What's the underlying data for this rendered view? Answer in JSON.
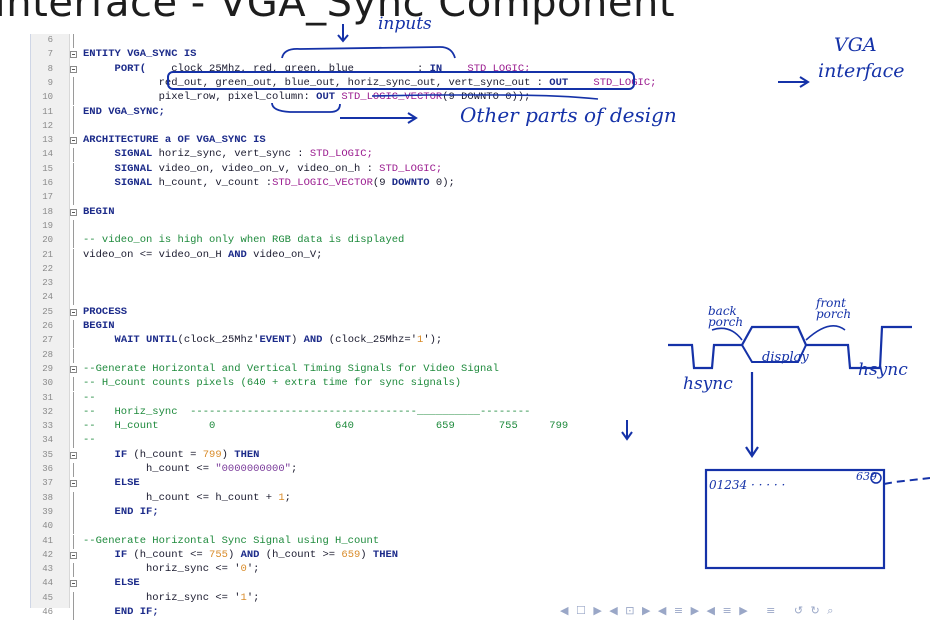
{
  "slide": {
    "title": "Interface - VGA_Sync Component"
  },
  "lines": [
    {
      "n": "6",
      "tokens": []
    },
    {
      "n": "7",
      "fold": true,
      "tokens": [
        {
          "t": "ENTITY VGA_SYNC IS",
          "c": "kw"
        }
      ]
    },
    {
      "n": "8",
      "fold": true,
      "tokens": [
        {
          "t": "     "
        },
        {
          "t": "PORT(",
          "c": "kw"
        },
        {
          "t": "    clock_25Mhz, red, green, blue          : "
        },
        {
          "t": "IN",
          "c": "kw"
        },
        {
          "t": "    "
        },
        {
          "t": "STD_LOGIC;",
          "c": "ty"
        }
      ]
    },
    {
      "n": "9",
      "tokens": [
        {
          "t": "            red_out, green_out, blue_out, horiz_sync_out, vert_sync_out : "
        },
        {
          "t": "OUT",
          "c": "kw"
        },
        {
          "t": "    "
        },
        {
          "t": "STD_LOGIC;",
          "c": "ty"
        }
      ]
    },
    {
      "n": "10",
      "tokens": [
        {
          "t": "            pixel_row, pixel_column: "
        },
        {
          "t": "OUT",
          "c": "kw"
        },
        {
          "t": " "
        },
        {
          "t": "STD_LOGIC_VECTOR",
          "c": "ty"
        },
        {
          "t": "(9 DOWNTO 0));"
        }
      ]
    },
    {
      "n": "11",
      "tokens": [
        {
          "t": "END VGA_SYNC;",
          "c": "kw"
        }
      ]
    },
    {
      "n": "12",
      "tokens": []
    },
    {
      "n": "13",
      "fold": true,
      "tokens": [
        {
          "t": "ARCHITECTURE a OF VGA_SYNC IS",
          "c": "kw"
        }
      ]
    },
    {
      "n": "14",
      "tokens": [
        {
          "t": "     "
        },
        {
          "t": "SIGNAL",
          "c": "kw"
        },
        {
          "t": " horiz_sync, vert_sync : "
        },
        {
          "t": "STD_LOGIC;",
          "c": "ty"
        }
      ]
    },
    {
      "n": "15",
      "tokens": [
        {
          "t": "     "
        },
        {
          "t": "SIGNAL",
          "c": "kw"
        },
        {
          "t": " video_on, video_on_v, video_on_h : "
        },
        {
          "t": "STD_LOGIC;",
          "c": "ty"
        }
      ]
    },
    {
      "n": "16",
      "tokens": [
        {
          "t": "     "
        },
        {
          "t": "SIGNAL",
          "c": "kw"
        },
        {
          "t": " h_count, v_count :"
        },
        {
          "t": "STD_LOGIC_VECTOR",
          "c": "ty"
        },
        {
          "t": "(9 "
        },
        {
          "t": "DOWNTO",
          "c": "kw"
        },
        {
          "t": " 0);"
        }
      ]
    },
    {
      "n": "17",
      "tokens": []
    },
    {
      "n": "18",
      "fold": true,
      "tokens": [
        {
          "t": "BEGIN",
          "c": "kw"
        }
      ]
    },
    {
      "n": "19",
      "tokens": []
    },
    {
      "n": "20",
      "tokens": [
        {
          "t": "-- video_on is high only when RGB data is displayed",
          "c": "cm"
        }
      ]
    },
    {
      "n": "21",
      "tokens": [
        {
          "t": "video_on <= video_on_H "
        },
        {
          "t": "AND",
          "c": "kw"
        },
        {
          "t": " video_on_V;"
        }
      ]
    },
    {
      "n": "22",
      "tokens": []
    },
    {
      "n": "23",
      "tokens": []
    },
    {
      "n": "24",
      "tokens": []
    },
    {
      "n": "25",
      "fold": true,
      "tokens": [
        {
          "t": "PROCESS",
          "c": "kw"
        }
      ]
    },
    {
      "n": "26",
      "tokens": [
        {
          "t": "BEGIN",
          "c": "kw"
        }
      ]
    },
    {
      "n": "27",
      "tokens": [
        {
          "t": "     "
        },
        {
          "t": "WAIT UNTIL",
          "c": "kw"
        },
        {
          "t": "(clock_25Mhz'"
        },
        {
          "t": "EVENT",
          "c": "kw"
        },
        {
          "t": ") "
        },
        {
          "t": "AND",
          "c": "kw"
        },
        {
          "t": " (clock_25Mhz='"
        },
        {
          "t": "1",
          "c": "nm"
        },
        {
          "t": "');"
        }
      ]
    },
    {
      "n": "28",
      "tokens": []
    },
    {
      "n": "29",
      "fold": true,
      "tokens": [
        {
          "t": "--Generate Horizontal and Vertical Timing Signals for Video Signal",
          "c": "cm"
        }
      ]
    },
    {
      "n": "30",
      "tokens": [
        {
          "t": "-- H_count counts pixels (640 + extra time for sync signals)",
          "c": "cm"
        }
      ]
    },
    {
      "n": "31",
      "tokens": [
        {
          "t": "--",
          "c": "cm"
        }
      ]
    },
    {
      "n": "32",
      "tokens": [
        {
          "t": "--   Horiz_sync  ------------------------------------__________--------",
          "c": "cm"
        }
      ]
    },
    {
      "n": "33",
      "tokens": [
        {
          "t": "--   H_count        0                   640             659       755     799",
          "c": "cm"
        }
      ]
    },
    {
      "n": "34",
      "tokens": [
        {
          "t": "--",
          "c": "cm"
        }
      ]
    },
    {
      "n": "35",
      "fold": true,
      "tokens": [
        {
          "t": "     "
        },
        {
          "t": "IF",
          "c": "kw"
        },
        {
          "t": " (h_count = "
        },
        {
          "t": "799",
          "c": "nm"
        },
        {
          "t": ") "
        },
        {
          "t": "THEN",
          "c": "kw"
        }
      ]
    },
    {
      "n": "36",
      "tokens": [
        {
          "t": "          h_count <= "
        },
        {
          "t": "\"0000000000\"",
          "c": "st"
        },
        {
          "t": ";"
        }
      ]
    },
    {
      "n": "37",
      "fold": true,
      "tokens": [
        {
          "t": "     "
        },
        {
          "t": "ELSE",
          "c": "kw"
        }
      ]
    },
    {
      "n": "38",
      "tokens": [
        {
          "t": "          h_count <= h_count + "
        },
        {
          "t": "1",
          "c": "nm"
        },
        {
          "t": ";"
        }
      ]
    },
    {
      "n": "39",
      "tokens": [
        {
          "t": "     "
        },
        {
          "t": "END IF;",
          "c": "kw"
        }
      ]
    },
    {
      "n": "40",
      "tokens": []
    },
    {
      "n": "41",
      "tokens": [
        {
          "t": "--Generate Horizontal Sync Signal using H_count",
          "c": "cm"
        }
      ]
    },
    {
      "n": "42",
      "fold": true,
      "tokens": [
        {
          "t": "     "
        },
        {
          "t": "IF",
          "c": "kw"
        },
        {
          "t": " (h_count <= "
        },
        {
          "t": "755",
          "c": "nm"
        },
        {
          "t": ") "
        },
        {
          "t": "AND",
          "c": "kw"
        },
        {
          "t": " (h_count >= "
        },
        {
          "t": "659",
          "c": "nm"
        },
        {
          "t": ") "
        },
        {
          "t": "THEN",
          "c": "kw"
        }
      ]
    },
    {
      "n": "43",
      "tokens": [
        {
          "t": "          horiz_sync <= '"
        },
        {
          "t": "0",
          "c": "nm"
        },
        {
          "t": "';"
        }
      ]
    },
    {
      "n": "44",
      "fold": true,
      "tokens": [
        {
          "t": "     "
        },
        {
          "t": "ELSE",
          "c": "kw"
        }
      ]
    },
    {
      "n": "45",
      "tokens": [
        {
          "t": "          horiz_sync <= '"
        },
        {
          "t": "1",
          "c": "nm"
        },
        {
          "t": "';"
        }
      ]
    },
    {
      "n": "46",
      "tokens": [
        {
          "t": "     "
        },
        {
          "t": "END IF;",
          "c": "kw"
        }
      ]
    }
  ],
  "annotations": {
    "inputs": "inputs",
    "vga_interface_1": "VGA",
    "vga_interface_2": "interface",
    "other_parts": "Other parts of design",
    "back_porch": "back porch",
    "front_porch": "front porch",
    "display": "display",
    "hsync_left": "hsync",
    "hsync_right": "hsync",
    "pixels_start": "01234 · · · · ·",
    "pixels_end": "639",
    "arrow_down": "↓"
  },
  "nav": {
    "controls": "◀ ☐ ▶ ◀ ⊡ ▶ ◀ ≡ ▶ ◀ ≡ ▶   ≡   ↺ ↻ ⌕"
  },
  "colors": {
    "ink": "#1532a8",
    "keyword": "#1c2b8a",
    "comment": "#1e8a3c",
    "type": "#9a1b8f",
    "number": "#d98c2b"
  }
}
